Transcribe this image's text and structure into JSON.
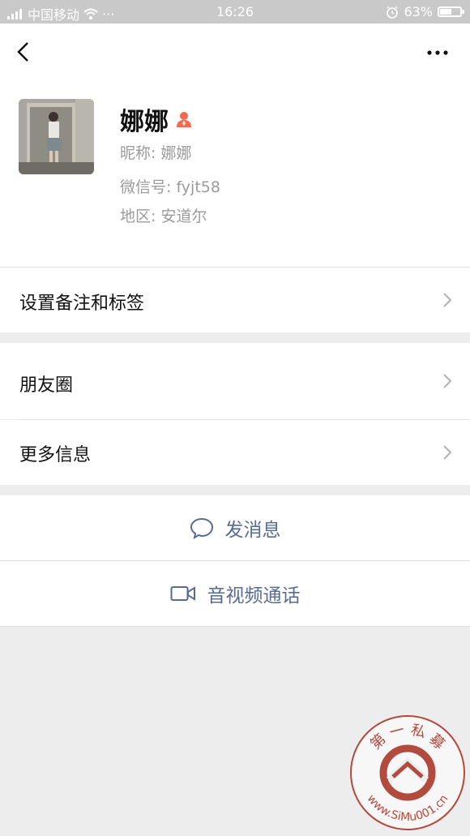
{
  "status_bar": {
    "carrier": "中国移动",
    "dots": "···",
    "time": "16:26",
    "battery_text": "63%",
    "battery_level": 0.63,
    "icons": [
      "signal-icon",
      "wifi-icon",
      "alarm-icon",
      "battery-icon"
    ]
  },
  "nav": {
    "back_icon": "chevron-left-icon",
    "more_icon": "more-dots-icon"
  },
  "profile": {
    "name": "娜娜",
    "gender_icon": "female-person-icon",
    "gender_color": "#fa5151",
    "nickname_line": "昵称: 娜娜",
    "wechat_id_line": "微信号: fyjt58",
    "region_line": "地区: 安道尔"
  },
  "rows": {
    "remark_label": "设置备注和标签",
    "moments_label": "朋友圈",
    "more_info_label": "更多信息"
  },
  "actions": {
    "message_label": "发消息",
    "message_icon": "chat-bubble-icon",
    "video_call_label": "音视频通话",
    "video_call_icon": "video-camera-icon",
    "accent_color": "#576b95"
  },
  "watermark": {
    "text_top": "第 一 私 募",
    "text_bottom": "www.SiMu001.cn"
  }
}
